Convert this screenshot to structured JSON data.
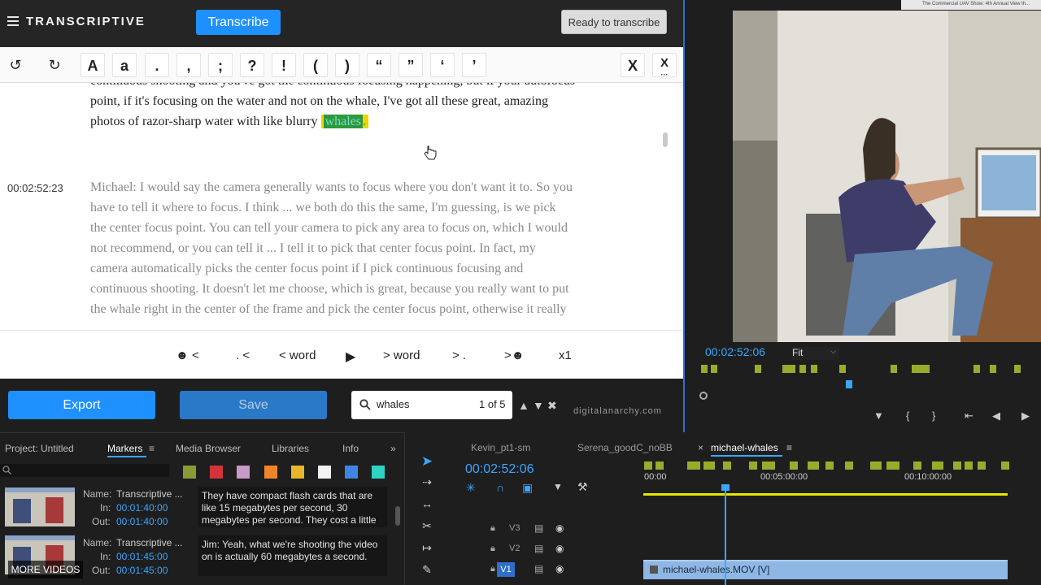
{
  "app": {
    "brand": "TRANSCRIPTIVE",
    "transcribe_label": "Transcribe",
    "status_label": "Ready to transcribe"
  },
  "toolbar": {
    "undo": "↺",
    "redo": "↻",
    "keys": [
      "A",
      "a",
      ".",
      ",",
      ";",
      "?",
      "!",
      "(",
      ")",
      "“",
      "”",
      "‘",
      "’"
    ],
    "close": "X",
    "close_alt": "X"
  },
  "transcript": {
    "para1_lines": [
      "continuous shooting and you've got the continuous focusing happening, but if your autofocus",
      "point, if it's focusing on the water and not on the whale, I've got all these great, amazing"
    ],
    "para1_last_prefix": "photos of razor-sharp water with like blurry",
    "highlight_word": "whales",
    "highlight_suffix": ".",
    "timecode2": "00:02:52:23",
    "para2_lines": [
      "Michael: I would say the camera generally wants to focus where you don't want it to. So you",
      "have to tell it where to focus. I think ... we both do this the same, I'm guessing, is we pick",
      "the center focus point. You can tell your camera to pick any area to focus on, which I would",
      "not recommend, or you can tell it ... I tell it to pick that center focus point. In fact, my",
      "camera automatically picks the center focus point if I pick continuous focusing and",
      "continuous shooting. It doesn't let me choose, which is great, because you really want to put",
      "the whale right in the center of the frame and pick the center focus point, otherwise it really"
    ]
  },
  "navigation": {
    "prev_speaker": "<",
    "prev_sentence": ". <",
    "prev_word": "< word",
    "play": "▶",
    "next_word": "> word",
    "next_sentence": "> .",
    "next_speaker": ">",
    "speed": "x1"
  },
  "actions": {
    "export_label": "Export",
    "save_label": "Save"
  },
  "search": {
    "value": "whales",
    "count": "1 of 5"
  },
  "credit": "digitalanarchy.com",
  "preview": {
    "timecode": "00:02:52:06",
    "zoom": "Fit",
    "banner": "The Commercial UAV Show: 4th Annual View th..."
  },
  "panel_tabs": {
    "project": "Project: Untitled",
    "markers": "Markers",
    "media_browser": "Media Browser",
    "libraries": "Libraries",
    "info": "Info",
    "more": "»"
  },
  "marker_colors": [
    "#8a9a35",
    "#d2343a",
    "#c79ac7",
    "#f0842a",
    "#e8b52c",
    "#f2f2f2",
    "#3d86e6",
    "#2fd3c4"
  ],
  "markers": [
    {
      "name_label": "Name:",
      "name": "Transcriptive ...",
      "in_label": "In:",
      "in": "00:01:40:00",
      "out_label": "Out:",
      "out": "00:01:40:00",
      "comment": "They have compact flash cards that are like 15 megabytes per second, 30 megabytes per second. They cost a little"
    },
    {
      "name_label": "Name:",
      "name": "Transcriptive ...",
      "in_label": "In:",
      "in": "00:01:45:00",
      "out_label": "Out:",
      "out": "00:01:45:00",
      "comment": "Jim: Yeah, what we're shooting the video on is actually 60 megabytes a second."
    }
  ],
  "more_videos": "MORE VIDEOS",
  "timeline": {
    "tabs": [
      "Kevin_pt1-sm",
      "Serena_goodC_noBB",
      "michael-whales"
    ],
    "timecode": "00:02:52:06",
    "ruler_labels": [
      "00:00",
      "00:05:00:00",
      "00:10:00:00"
    ],
    "tracks": [
      "V3",
      "V2",
      "V1"
    ],
    "clip_name": "michael-whales.MOV [V]"
  }
}
